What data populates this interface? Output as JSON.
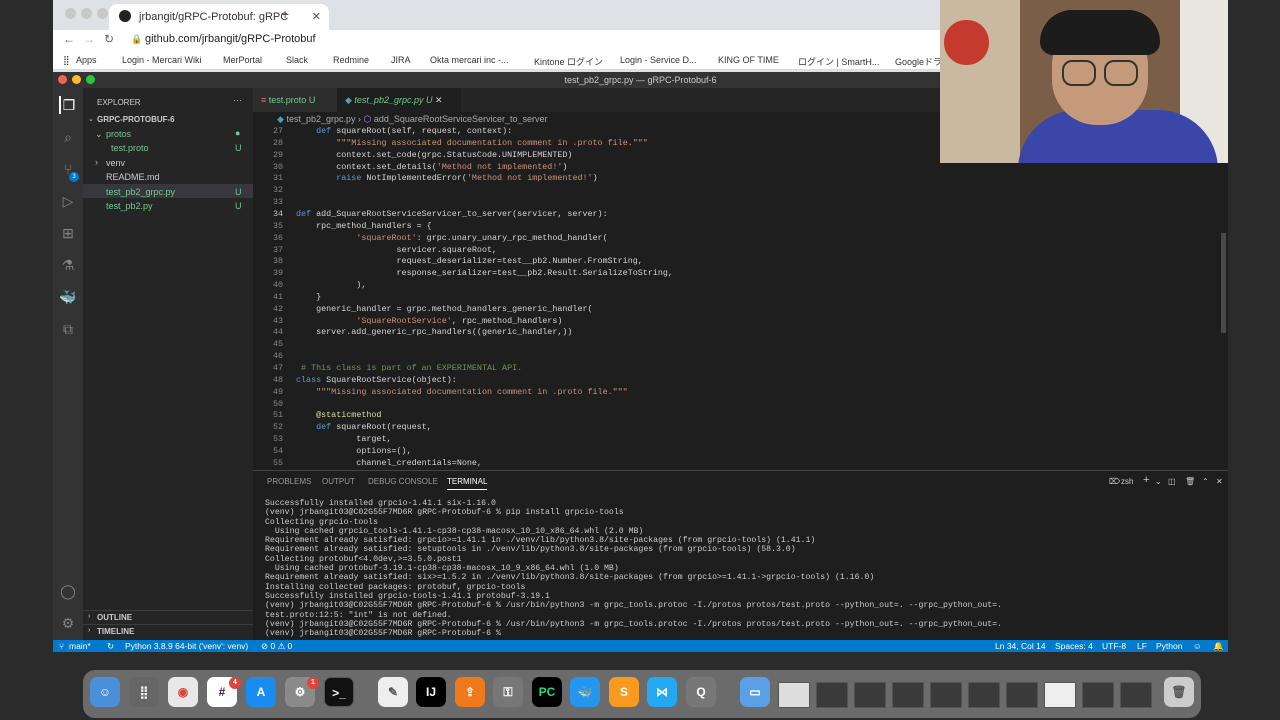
{
  "browser": {
    "tab_title": "jrbangit/gRPC-Protobuf: gRPC",
    "url": "github.com/jrbangit/gRPC-Protobuf",
    "bookmarks": [
      "Apps",
      "Login - Mercari Wiki",
      "MerPortal",
      "Slack",
      "Redmine",
      "JIRA",
      "Okta mercari inc -...",
      "Kintone ログイン",
      "Login - Service D...",
      "KING OF TIME",
      "ログイン | SmartH...",
      "Googleドラ"
    ]
  },
  "vscode": {
    "window_title": "test_pb2_grpc.py — gRPC-Protobuf-6",
    "explorer": {
      "header": "EXPLORER",
      "root": "GRPC-PROTOBUF-6",
      "items": [
        {
          "label": "protos",
          "status": ""
        },
        {
          "label": "test.proto",
          "status": "U"
        },
        {
          "label": "venv",
          "status": ""
        },
        {
          "label": "README.md",
          "status": ""
        },
        {
          "label": "test_pb2_grpc.py",
          "status": "U"
        },
        {
          "label": "test_pb2.py",
          "status": "U"
        }
      ],
      "outline": "OUTLINE",
      "timeline": "TIMELINE"
    },
    "tabs": [
      {
        "label": "test.proto",
        "status": "U"
      },
      {
        "label": "test_pb2_grpc.py",
        "status": "U"
      }
    ],
    "breadcrumb": {
      "file": "test_pb2_grpc.py",
      "symbol": "add_SquareRootServiceServicer_to_server"
    },
    "code_lines": [
      {
        "n": "27",
        "t": "    def squareRoot(self, request, context):"
      },
      {
        "n": "28",
        "t": "        \"\"\"Missing associated documentation comment in .proto file.\"\"\""
      },
      {
        "n": "29",
        "t": "        context.set_code(grpc.StatusCode.UNIMPLEMENTED)"
      },
      {
        "n": "30",
        "t": "        context.set_details('Method not implemented!')"
      },
      {
        "n": "31",
        "t": "        raise NotImplementedError('Method not implemented!')"
      },
      {
        "n": "32",
        "t": ""
      },
      {
        "n": "33",
        "t": ""
      },
      {
        "n": "34",
        "t": "def add_SquareRootServiceServicer_to_server(servicer, server):"
      },
      {
        "n": "35",
        "t": "    rpc_method_handlers = {"
      },
      {
        "n": "36",
        "t": "            'squareRoot': grpc.unary_unary_rpc_method_handler("
      },
      {
        "n": "37",
        "t": "                    servicer.squareRoot,"
      },
      {
        "n": "38",
        "t": "                    request_deserializer=test__pb2.Number.FromString,"
      },
      {
        "n": "39",
        "t": "                    response_serializer=test__pb2.Result.SerializeToString,"
      },
      {
        "n": "40",
        "t": "            ),"
      },
      {
        "n": "41",
        "t": "    }"
      },
      {
        "n": "42",
        "t": "    generic_handler = grpc.method_handlers_generic_handler("
      },
      {
        "n": "43",
        "t": "            'SquareRootService', rpc_method_handlers)"
      },
      {
        "n": "44",
        "t": "    server.add_generic_rpc_handlers((generic_handler,))"
      },
      {
        "n": "45",
        "t": ""
      },
      {
        "n": "46",
        "t": ""
      },
      {
        "n": "47",
        "t": " # This class is part of an EXPERIMENTAL API."
      },
      {
        "n": "48",
        "t": "class SquareRootService(object):"
      },
      {
        "n": "49",
        "t": "    \"\"\"Missing associated documentation comment in .proto file.\"\"\""
      },
      {
        "n": "50",
        "t": ""
      },
      {
        "n": "51",
        "t": "    @staticmethod"
      },
      {
        "n": "52",
        "t": "    def squareRoot(request,"
      },
      {
        "n": "53",
        "t": "            target,"
      },
      {
        "n": "54",
        "t": "            options=(),"
      },
      {
        "n": "55",
        "t": "            channel_credentials=None,"
      }
    ],
    "panel_tabs": [
      "PROBLEMS",
      "OUTPUT",
      "DEBUG CONSOLE",
      "TERMINAL"
    ],
    "terminal_shell": "zsh",
    "terminal_lines": [
      "Successfully installed grpcio-1.41.1 six-1.16.0",
      "(venv) jrbangit03@C02G55F7MD6R gRPC-Protobuf-6 % pip install grpcio-tools",
      "Collecting grpcio-tools",
      "  Using cached grpcio_tools-1.41.1-cp38-cp38-macosx_10_10_x86_64.whl (2.0 MB)",
      "Requirement already satisfied: grpcio>=1.41.1 in ./venv/lib/python3.8/site-packages (from grpcio-tools) (1.41.1)",
      "Requirement already satisfied: setuptools in ./venv/lib/python3.8/site-packages (from grpcio-tools) (58.3.0)",
      "Collecting protobuf<4.0dev,>=3.5.0.post1",
      "  Using cached protobuf-3.19.1-cp38-cp38-macosx_10_9_x86_64.whl (1.0 MB)",
      "Requirement already satisfied: six>=1.5.2 in ./venv/lib/python3.8/site-packages (from grpcio>=1.41.1->grpcio-tools) (1.16.0)",
      "Installing collected packages: protobuf, grpcio-tools",
      "Successfully installed grpcio-tools-1.41.1 protobuf-3.19.1",
      "(venv) jrbangit03@C02G55F7MD6R gRPC-Protobuf-6 % /usr/bin/python3 -m grpc_tools.protoc -I./protos protos/test.proto --python_out=. --grpc_python_out=.",
      "test.proto:12:5: \"int\" is not defined.",
      "(venv) jrbangit03@C02G55F7MD6R gRPC-Protobuf-6 % /usr/bin/python3 -m grpc_tools.protoc -I./protos protos/test.proto --python_out=. --grpc_python_out=.",
      "(venv) jrbangit03@C02G55F7MD6R gRPC-Protobuf-6 % "
    ],
    "status": {
      "branch": "main*",
      "python": "Python 3.8.9 64-bit ('venv': venv)",
      "problems": "⊘ 0 ⚠ 0",
      "position": "Ln 34, Col 14",
      "spaces": "Spaces: 4",
      "encoding": "UTF-8",
      "eol": "LF",
      "language": "Python"
    }
  },
  "dock": {
    "chrome_badge": "4",
    "settings_badge": "1",
    "intellij_label": "IJ",
    "pycharm_label": "PC"
  },
  "colors": {
    "accent": "#007acc",
    "keyword": "#569cd6",
    "string": "#ce9178",
    "function": "#dcdcaa",
    "comment": "#6a9955",
    "class": "#4ec9b0",
    "param": "#9cdcfe",
    "untracked": "#73c991"
  }
}
